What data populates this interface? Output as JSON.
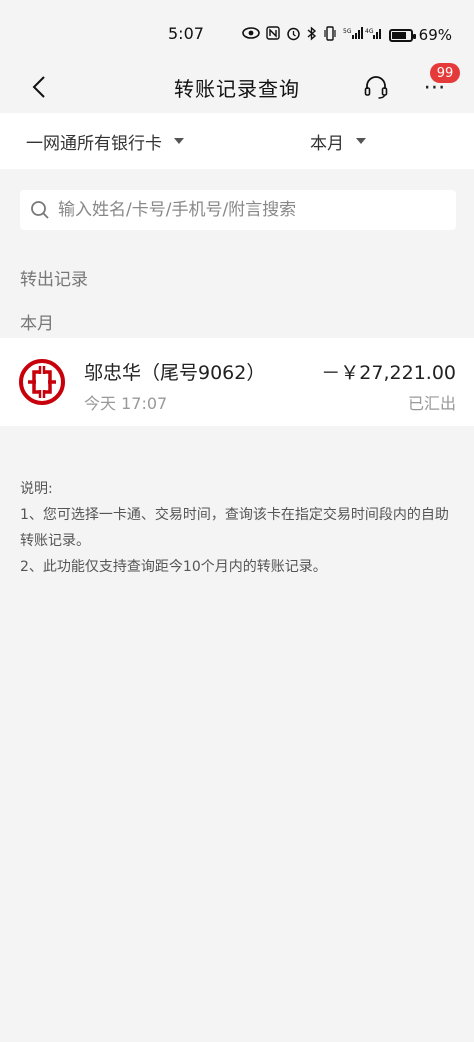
{
  "status_bar": {
    "time": "5:07",
    "battery": "69%",
    "network_labels": [
      "5G",
      "4G"
    ]
  },
  "header": {
    "title": "转账记录查询",
    "badge_count": "99",
    "more_label": "⋯"
  },
  "filters": {
    "card": "一网通所有银行卡",
    "period": "本月"
  },
  "search": {
    "placeholder": "输入姓名/卡号/手机号/附言搜索",
    "value": ""
  },
  "sections": {
    "outgoing": "转出记录",
    "month": "本月"
  },
  "records": [
    {
      "name": "邬忠华（尾号9062）",
      "date": "今天 17:07",
      "amount": "－￥27,221.00",
      "status": "已汇出"
    }
  ],
  "notes": {
    "title": "说明:",
    "line1": "1、您可选择一卡通、交易时间，查询该卡在指定交易时间段内的自助转账记录。",
    "line2": "2、此功能仅支持查询距今10个月内的转账记录。"
  },
  "colors": {
    "background": "#f4f4f4",
    "badge": "#e43a3a",
    "bank_logo": "#c7000b"
  },
  "icons": [
    "eye-icon",
    "nfc-icon",
    "alarm-icon",
    "bluetooth-icon",
    "vibrate-icon",
    "signal-icon",
    "battery-icon",
    "back-icon",
    "headset-icon",
    "more-icon",
    "search-icon",
    "icbc-logo-icon"
  ]
}
